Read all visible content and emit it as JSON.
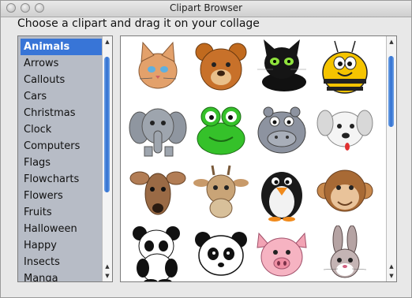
{
  "window": {
    "title": "Clipart Browser"
  },
  "instruction": "Choose a clipart and drag it on your collage",
  "categories": [
    {
      "label": "Animals",
      "selected": true
    },
    {
      "label": "Arrows"
    },
    {
      "label": "Callouts"
    },
    {
      "label": "Cars"
    },
    {
      "label": "Christmas"
    },
    {
      "label": "Clock"
    },
    {
      "label": "Computers"
    },
    {
      "label": "Flags"
    },
    {
      "label": "Flowcharts"
    },
    {
      "label": "Flowers"
    },
    {
      "label": "Fruits"
    },
    {
      "label": "Halloween"
    },
    {
      "label": "Happy"
    },
    {
      "label": "Insects"
    },
    {
      "label": "Manga"
    }
  ],
  "cliparts": [
    {
      "name": "cat-clipart"
    },
    {
      "name": "bear-clipart"
    },
    {
      "name": "black-cat-clipart"
    },
    {
      "name": "bee-clipart"
    },
    {
      "name": "elephant-clipart"
    },
    {
      "name": "frog-clipart"
    },
    {
      "name": "hippo-clipart"
    },
    {
      "name": "dog-clipart"
    },
    {
      "name": "deer-clipart"
    },
    {
      "name": "giraffe-clipart"
    },
    {
      "name": "penguin-clipart"
    },
    {
      "name": "monkey-clipart"
    },
    {
      "name": "panda-clipart"
    },
    {
      "name": "panda-face-clipart"
    },
    {
      "name": "pig-clipart"
    },
    {
      "name": "rabbit-clipart"
    }
  ],
  "colors": {
    "selection": "#3875d7",
    "list_background": "#b7bcc6"
  }
}
